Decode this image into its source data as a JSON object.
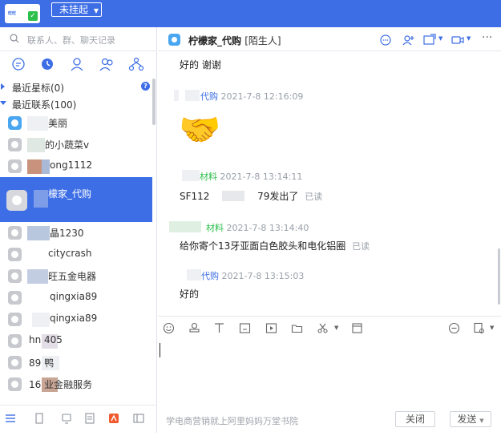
{
  "topbar": {
    "avatar_text": "旺旺",
    "status_label": "未挂起"
  },
  "sidebar": {
    "search_placeholder": "联系人、群、聊天记录",
    "groups": {
      "starred": "最近星标(0)",
      "recent": "最近联系(100)"
    },
    "contacts": [
      {
        "name": "美丽"
      },
      {
        "name": "的小蔬菜v"
      },
      {
        "name": "ong1112"
      },
      {
        "name": "檬家_代购"
      },
      {
        "name": "晶1230"
      },
      {
        "name": "citycrash"
      },
      {
        "name": "旺五金电器"
      },
      {
        "name": "qingxia89"
      },
      {
        "name": "qingxia89"
      },
      {
        "name": "hn      405"
      },
      {
        "name": "89      鸭"
      },
      {
        "name": "16      业金融服务"
      }
    ]
  },
  "chat": {
    "title": "柠檬家_代购",
    "tag": "[陌生人]",
    "messages": [
      {
        "text": "好的 谢谢"
      },
      {
        "sender": "代购",
        "time": "2021-7-8 12:16:09",
        "emoji": "🤝"
      },
      {
        "sender": "材料",
        "time": "2021-7-8 13:14:11",
        "text_a": "SF112",
        "text_b": "79发出了",
        "read": "已读"
      },
      {
        "sender": "材料",
        "time": "2021-7-8 13:14:40",
        "text": "给你寄个13牙亚面白色胶头和电化铝圈",
        "read": "已读"
      },
      {
        "sender": "代购",
        "time": "2021-7-8 13:15:03",
        "text": "好的"
      }
    ]
  },
  "footer": {
    "hint": "学电商营销就上阿里妈妈万堂书院",
    "close_label": "关闭",
    "send_label": "发送"
  },
  "colors": {
    "accent": "#3d6ee6",
    "green": "#2bbf4b"
  }
}
